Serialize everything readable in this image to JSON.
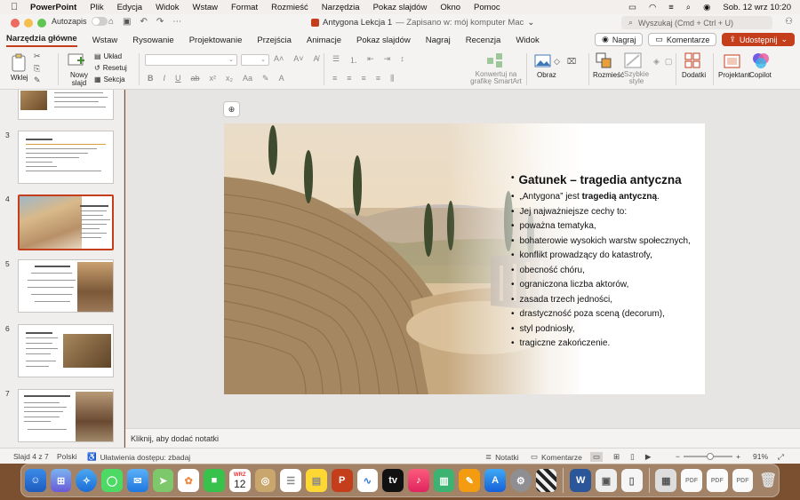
{
  "menubar": {
    "app": "PowerPoint",
    "items": [
      "Plik",
      "Edycja",
      "Widok",
      "Wstaw",
      "Format",
      "Rozmieść",
      "Narzędzia",
      "Pokaz slajdów",
      "Okno",
      "Pomoc"
    ],
    "clock": "Sob. 12 wrz  10:20"
  },
  "titlebar": {
    "autosave_label": "Autozapis",
    "doc_name": "Antygona Lekcja 1",
    "doc_status": "— Zapisano w: mój komputer Mac",
    "search_placeholder": "Wyszukaj (Cmd + Ctrl + U)"
  },
  "ribbon": {
    "tabs": [
      "Narzędzia główne",
      "Wstaw",
      "Rysowanie",
      "Projektowanie",
      "Przejścia",
      "Animacje",
      "Pokaz slajdów",
      "Nagraj",
      "Recenzja",
      "Widok"
    ],
    "record_label": "Nagraj",
    "comments_label": "Komentarze",
    "share_label": "Udostępnij",
    "paste_label": "Wklej",
    "new_slide_label": "Nowy slajd",
    "layout_label": "Układ",
    "reset_label": "Resetuj",
    "section_label": "Sekcja",
    "smartart_label": "Konwertuj na grafikę SmartArt",
    "picture_label": "Obraz",
    "arrange_label": "Rozmieść",
    "quick_styles_label": "Szybkie style",
    "addins_label": "Dodatki",
    "designer_label": "Projektant",
    "copilot_label": "Copilot"
  },
  "thumbnails": [
    {
      "num": "",
      "selected": false
    },
    {
      "num": "3",
      "selected": false
    },
    {
      "num": "4",
      "selected": true
    },
    {
      "num": "5",
      "selected": false
    },
    {
      "num": "6",
      "selected": false
    },
    {
      "num": "7",
      "selected": false
    }
  ],
  "slide": {
    "title": "Gatunek – tragedia antyczna",
    "intro_plain": "„Antygona” jest ",
    "intro_bold": "tragedią antyczną",
    "intro_end": ".",
    "bullets": [
      "Jej najważniejsze cechy to:",
      "poważna tematyka,",
      "bohaterowie wysokich warstw społecznych,",
      "konflikt prowadzący do katastrofy,",
      "obecność chóru,",
      "ograniczona liczba aktorów,",
      "zasada trzech jedności,",
      "drastyczność poza sceną (decorum),",
      "styl podniosły,",
      "tragiczne zakończenie."
    ]
  },
  "notes": {
    "placeholder": "Kliknij, aby dodać notatki"
  },
  "statusbar": {
    "slide_info": "Slajd 4 z 7",
    "language": "Polski",
    "accessibility": "Ułatwienia dostępu: zbadaj",
    "notes_label": "Notatki",
    "comments_label": "Komentarze",
    "zoom": "91%"
  },
  "dock": {
    "calendar_month": "WRZ",
    "calendar_day": "12"
  },
  "colors": {
    "accent": "#c43e1c"
  }
}
